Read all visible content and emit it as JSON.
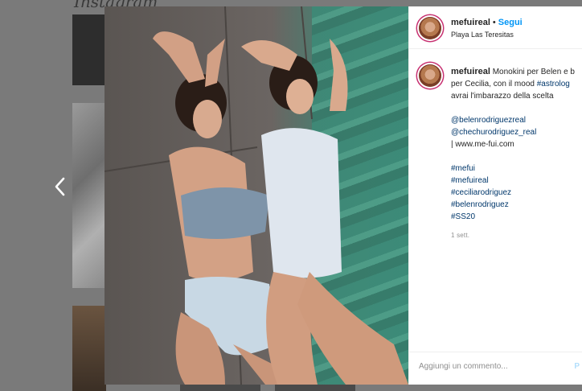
{
  "background": {
    "logo_text": "Instagram"
  },
  "nav": {
    "prev_icon": "chevron-left-icon"
  },
  "post": {
    "username": "mefuireal",
    "separator": "•",
    "follow_label": "Segui",
    "location": "Playa Las Teresitas",
    "more_icon": "ellipsis-icon",
    "caption": {
      "username": "mefuireal",
      "text_line1": "Monokini per Belen e b",
      "text_line2_prefix": "per Cecilia, con il mood ",
      "text_line2_link": "#astrolog",
      "text_line3": "avrai l'imbarazzo della scelta",
      "mention1": "@belenrodriguezreal",
      "mention2": "@chechurodriguez_real",
      "website": "| www.me-fui.com",
      "hashtags": [
        "#mefui",
        "#mefuireal",
        "#ceciliarodriguez",
        "#belenrodriguez",
        "#SS20"
      ]
    },
    "time_ago": "1 sett.",
    "comment_placeholder": "Aggiungi un commento...",
    "post_label": "P"
  },
  "colors": {
    "link": "#00376b",
    "follow": "#0095f6",
    "story_ring": "#c83272"
  }
}
